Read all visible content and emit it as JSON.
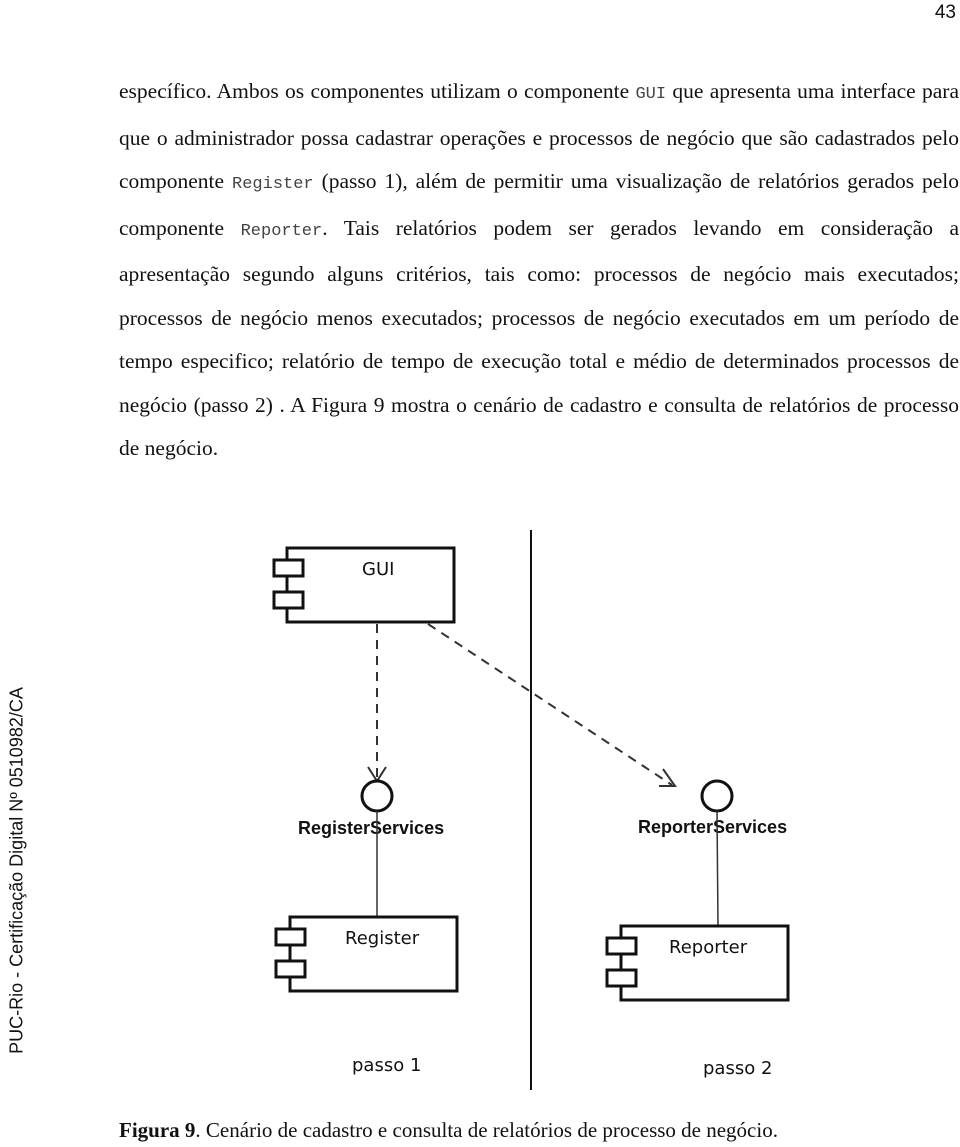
{
  "page_number": "43",
  "side_watermark": "PUC-Rio - Certificação Digital Nº 0510982/CA",
  "paragraph": {
    "t1": "específico. Ambos os componentes utilizam o componente ",
    "c1": "GUI",
    "t2": " que apresenta uma interface para que o administrador possa cadastrar operações e processos de negócio que são cadastrados pelo componente ",
    "c2": "Register",
    "t3": " (passo 1), além de permitir uma visualização de relatórios gerados pelo componente ",
    "c3": "Reporter",
    "t4": ". Tais relatórios podem ser gerados levando em consideração a apresentação segundo alguns critérios, tais como: processos de negócio mais executados; processos de negócio menos executados; processos de negócio executados em um período de tempo especifico; relatório de tempo de execução total e médio de determinados processos de negócio (passo 2) . A Figura 9 mostra o cenário de cadastro e consulta de relatórios de processo de negócio."
  },
  "diagram": {
    "components": {
      "gui": "GUI",
      "register": "Register",
      "reporter": "Reporter"
    },
    "interfaces": {
      "register_services": "RegisterServices",
      "reporter_services": "ReporterServices"
    },
    "steps": {
      "step1": "passo 1",
      "step2": "passo 2"
    }
  },
  "caption": {
    "label": "Figura 9",
    "text": ". Cenário de cadastro e consulta de relatórios de processo de negócio."
  }
}
